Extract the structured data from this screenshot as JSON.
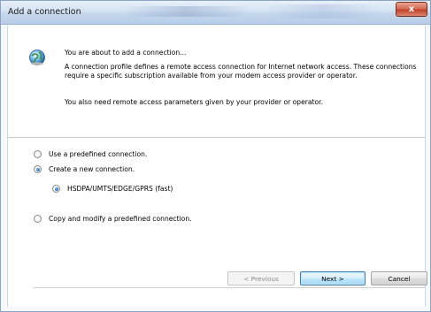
{
  "window": {
    "title": "Add a connection",
    "close_glyph": "x"
  },
  "intro": {
    "icon": "info-globe-icon",
    "title": "You are about to add a connection...",
    "description": "A connection profile defines a remote access connection for Internet network access. These connections require a specific subscription available from your modem access provider or operator.",
    "note": "You also need remote access parameters given by your provider or operator."
  },
  "options": [
    {
      "label": "Use a predefined connection.",
      "checked": false
    },
    {
      "label": "Create a new connection.",
      "checked": true
    },
    {
      "label": "HSDPA/UMTS/EDGE/GPRS (fast)",
      "checked": true
    },
    {
      "label": "Copy and modify a predefined connection.",
      "checked": false
    }
  ],
  "buttons": {
    "previous": "< Previous",
    "next": "Next >",
    "cancel": "Cancel"
  }
}
